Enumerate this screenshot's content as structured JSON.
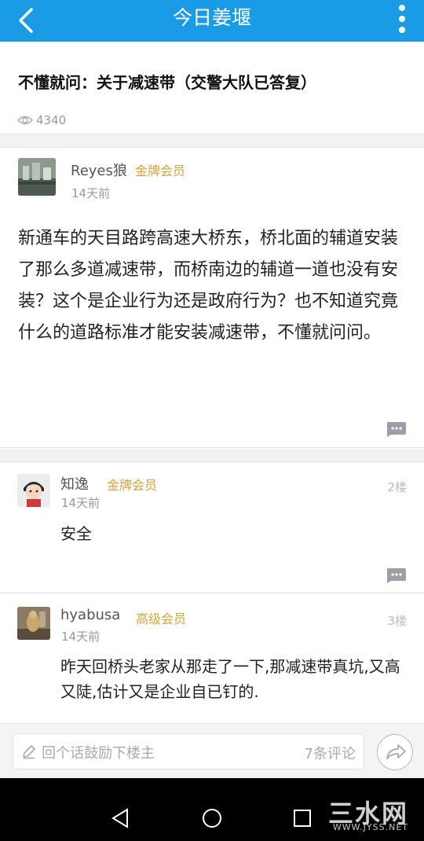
{
  "header": {
    "title": "今日姜堰"
  },
  "post": {
    "title": "不懂就问：关于减速带（交警大队已答复）",
    "views": "4340",
    "author": "Reyes狼",
    "badge": "金牌会员",
    "time": "14天前",
    "body": "新通车的天目路跨高速大桥东，桥北面的辅道安装了那么多道减速带，而桥南边的辅道一道也没有安装？这个是企业行为还是政府行为？也不知道究竟什么的道路标准才能安装减速带，不懂就问问。"
  },
  "replies": [
    {
      "author": "知逸",
      "badge": "金牌会员",
      "time": "14天前",
      "floor": "2楼",
      "body": "安全"
    },
    {
      "author": "hyabusa",
      "badge": "高级会员",
      "time": "14天前",
      "floor": "3楼",
      "body": "昨天回桥头老家从那走了一下,那减速带真坑,又高又陡,估计又是企业自已钉的."
    }
  ],
  "bottom": {
    "placeholder": "回个话鼓励下楼主",
    "comment_count": "7条评论"
  },
  "watermark": {
    "big": "三水网",
    "small": "WWW.JYSS.NET"
  },
  "colors": {
    "topbar": "#1a9be6",
    "badge": "#d4a33a"
  }
}
